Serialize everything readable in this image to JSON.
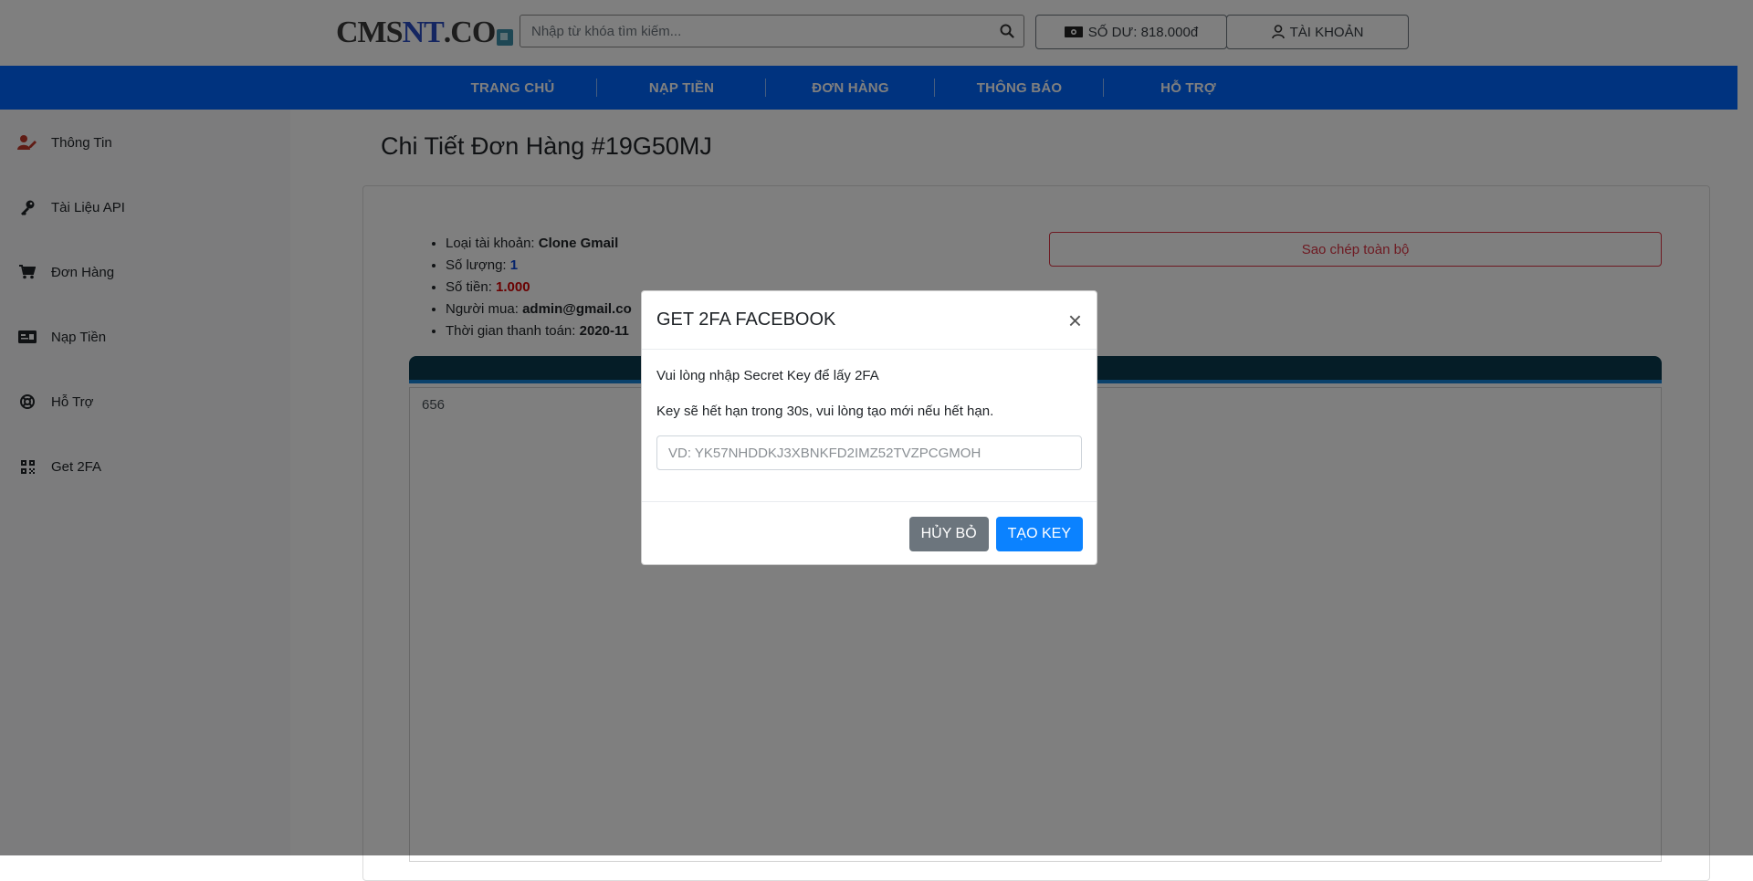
{
  "header": {
    "logo": {
      "part1": "CMS",
      "part2": "NT",
      "part3": ".CO"
    },
    "search_placeholder": "Nhập từ khóa tìm kiếm...",
    "balance_label": "SỐ DƯ: 818.000đ",
    "account_label": "TÀI KHOẢN"
  },
  "nav": {
    "items": [
      "TRANG CHỦ",
      "NẠP TIỀN",
      "ĐƠN HÀNG",
      "THÔNG BÁO",
      "HỖ TRỢ"
    ]
  },
  "sidebar": {
    "items": [
      {
        "label": "Thông Tin",
        "icon": "user-edit-icon"
      },
      {
        "label": "Tài Liệu API",
        "icon": "key-icon"
      },
      {
        "label": "Đơn Hàng",
        "icon": "cart-icon"
      },
      {
        "label": "Nạp Tiền",
        "icon": "money-check-icon"
      },
      {
        "label": "Hỗ Trợ",
        "icon": "life-ring-icon"
      },
      {
        "label": "Get 2FA",
        "icon": "qrcode-icon"
      }
    ]
  },
  "main": {
    "title": "Chi Tiết Đơn Hàng #19G50MJ",
    "info": {
      "account_type_label": "Loại tài khoản:",
      "account_type": "Clone Gmail",
      "quantity_label": "Số lượng:",
      "quantity": "1",
      "amount_label": "Số tiền:",
      "amount": "1.000",
      "buyer_label": "Người mua:",
      "buyer": "admin@gmail.co",
      "paid_time_label": "Thời gian thanh toán:",
      "paid_time": "2020-11"
    },
    "copy_all_label": "Sao chép toàn bộ",
    "panel_value": "656"
  },
  "modal": {
    "title": "GET 2FA FACEBOOK",
    "close_symbol": "×",
    "line1": "Vui lòng nhập Secret Key để lấy 2FA",
    "line2": "Key sẽ hết hạn trong 30s, vui lòng tạo mới nếu hết hạn.",
    "input_placeholder": "VD: YK57NHDDKJ3XBNKFD2IMZ52TVZPCGMOH",
    "cancel_label": "HỦY BỎ",
    "create_label": "TẠO KEY"
  },
  "colors": {
    "nav_blue": "#0066ff",
    "accent_red": "#dc3545",
    "panel_dark": "#0b3b4f"
  }
}
